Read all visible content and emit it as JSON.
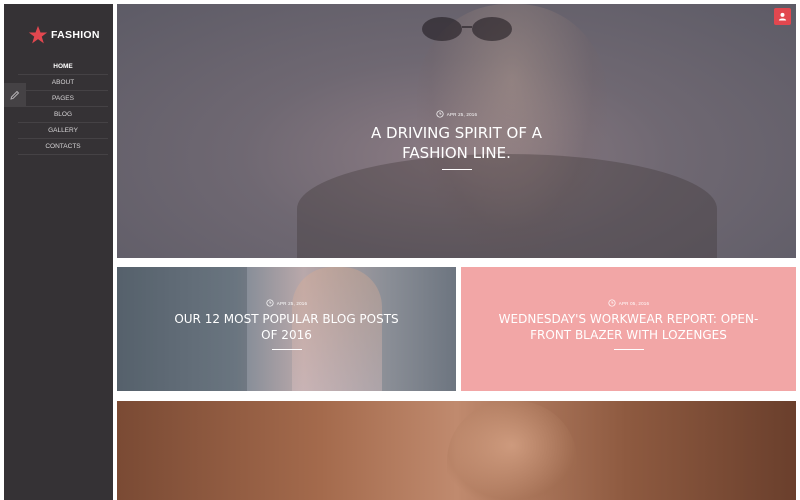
{
  "brand": {
    "name": "FASHION",
    "accent": "#e2474f"
  },
  "nav": {
    "items": [
      {
        "label": "HOME",
        "active": true
      },
      {
        "label": "ABOUT",
        "active": false
      },
      {
        "label": "PAGES",
        "active": false
      },
      {
        "label": "BLOG",
        "active": false
      },
      {
        "label": "GALLERY",
        "active": false
      },
      {
        "label": "CONTACTS",
        "active": false
      }
    ]
  },
  "icons": {
    "edit": "pencil-icon",
    "user": "user-icon",
    "date": "clock-icon",
    "logo": "star-icon"
  },
  "posts": [
    {
      "date": "APR 25, 2016",
      "title": "A DRIVING SPIRIT OF A FASHION LINE."
    },
    {
      "date": "APR 25, 2016",
      "title": "OUR 12 MOST POPULAR BLOG POSTS OF 2016"
    },
    {
      "date": "APR 05, 2016",
      "title": "WEDNESDAY'S WORKWEAR REPORT: OPEN-FRONT BLAZER WITH LOZENGES"
    }
  ],
  "colors": {
    "sidebar": "#353235",
    "pink_tile": "#f2a6a6"
  }
}
